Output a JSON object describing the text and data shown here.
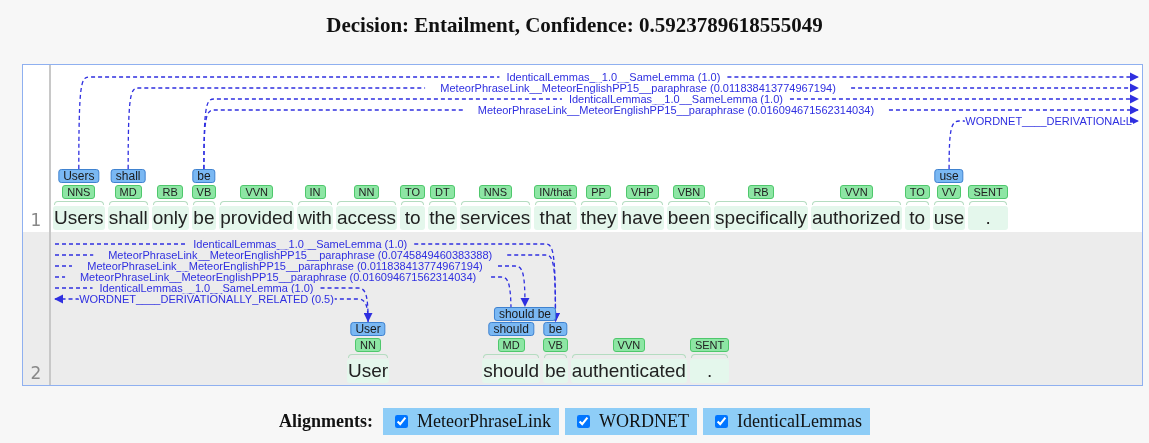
{
  "title": "Decision: Entailment, Confidence: 0.5923789618555049",
  "rows": [
    {
      "number": "1",
      "tokens": [
        {
          "word": "Users",
          "tag": "NNS",
          "spans": [
            {
              "label": "Users",
              "covers_next": false,
              "arcs": [
                {
                  "label": "IdenticalLemmas__1.0__SameLemma (1.0)",
                  "kind": "right"
                }
              ]
            }
          ]
        },
        {
          "word": "shall",
          "tag": "MD",
          "spans": [
            {
              "label": "shall",
              "covers_next": false,
              "arcs": [
                {
                  "label": "MeteorPhraseLink__MeteorEnglishPP15__paraphrase (0.011838413774967194)",
                  "kind": "right"
                }
              ]
            }
          ]
        },
        {
          "word": "only",
          "tag": "RB"
        },
        {
          "word": "be",
          "tag": "VB",
          "spans": [
            {
              "label": "be",
              "covers_next": false,
              "arcs": [
                {
                  "label": "IdenticalLemmas__1.0__SameLemma (1.0)",
                  "kind": "right"
                },
                {
                  "label": "MeteorPhraseLink__MeteorEnglishPP15__paraphrase (0.016094671562314034)",
                  "kind": "right"
                }
              ]
            }
          ]
        },
        {
          "word": "provided",
          "tag": "VVN"
        },
        {
          "word": "with",
          "tag": "IN"
        },
        {
          "word": "access",
          "tag": "NN"
        },
        {
          "word": "to",
          "tag": "TO"
        },
        {
          "word": "the",
          "tag": "DT"
        },
        {
          "word": "services",
          "tag": "NNS"
        },
        {
          "word": "that",
          "tag": "IN/that"
        },
        {
          "word": "they",
          "tag": "PP"
        },
        {
          "word": "have",
          "tag": "VHP"
        },
        {
          "word": "been",
          "tag": "VBN"
        },
        {
          "word": "specifically",
          "tag": "RB"
        },
        {
          "word": "authorized",
          "tag": "VVN"
        },
        {
          "word": "to",
          "tag": "TO"
        },
        {
          "word": "use",
          "tag": "VV",
          "spans": [
            {
              "label": "use",
              "covers_next": false,
              "arcs": [
                {
                  "label": "WORDNET____DERIVATIONALL",
                  "kind": "right"
                }
              ]
            }
          ]
        },
        {
          "word": ".",
          "tag": "SENT"
        }
      ]
    },
    {
      "number": "2",
      "tokens": [
        {
          "word": "User",
          "tag": "NN",
          "spans": [
            {
              "label": "User",
              "covers_next": false,
              "arcs": [
                {
                  "label": "IdenticalLemmas__1.0__SameLemma (1.0)",
                  "kind": "incoming"
                },
                {
                  "label": "WORDNET____DERIVATIONALLY_RELATED (0.5)",
                  "kind": "left"
                }
              ]
            }
          ]
        },
        {
          "word": "should",
          "tag": "MD",
          "spans": [
            {
              "label": "should be",
              "covers_next": true,
              "arcs": [
                {
                  "label": "MeteorPhraseLink__MeteorEnglishPP15__paraphrase (0.011838413774967194)",
                  "kind": "incoming"
                }
              ]
            },
            {
              "label": "should",
              "covers_next": false,
              "arcs": [
                {
                  "label": "MeteorPhraseLink__MeteorEnglishPP15__paraphrase (0.016094671562314034)",
                  "kind": "incoming"
                }
              ]
            }
          ]
        },
        {
          "word": "be",
          "tag": "VB",
          "spans": [
            {
              "label": "be",
              "covers_next": false,
              "arcs": [
                {
                  "label": "IdenticalLemmas__1.0__SameLemma (1.0)",
                  "kind": "incoming"
                },
                {
                  "label": "MeteorPhraseLink__MeteorEnglishPP15__paraphrase (0.0745849460383388)",
                  "kind": "incoming"
                }
              ]
            }
          ]
        },
        {
          "word": "authenticated",
          "tag": "VVN"
        },
        {
          "word": ".",
          "tag": "SENT"
        }
      ]
    }
  ],
  "alignments": {
    "label": "Alignments:",
    "options": [
      {
        "label": "MeteorPhraseLink",
        "checked": true
      },
      {
        "label": "WORDNET",
        "checked": true
      },
      {
        "label": "IdenticalLemmas",
        "checked": true
      }
    ]
  }
}
